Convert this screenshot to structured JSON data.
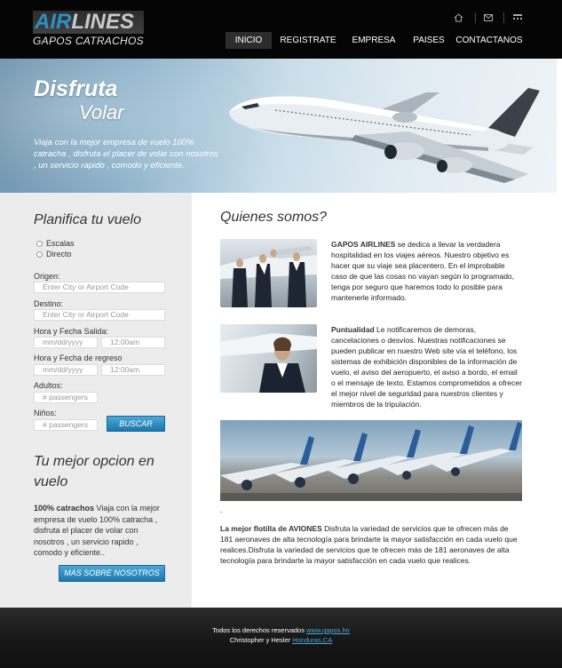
{
  "header": {
    "logo_air": "AIR",
    "logo_lines": "LINES",
    "logo_sub": "GAPOS CATRACHOS",
    "icons": [
      "home-icon",
      "mail-icon",
      "sitemap-icon"
    ],
    "nav": [
      "INICIO",
      "REGISTRATE",
      "EMPRESA",
      "PAISES",
      "CONTACTANOS"
    ]
  },
  "banner": {
    "title": "Disfruta",
    "subtitle": "Volar",
    "text": "Viaja con la mejor empresa de vuelo 100% catracha , disfruta el placer de volar con nosotros , un servicio rapido , comodo y eficiente."
  },
  "sidebar": {
    "title": "Planifica tu vuelo",
    "radio_escalas": "Escalas",
    "radio_directo": "Directo",
    "origen_label": "Origen:",
    "origen_placeholder": "Enter City or Airport Code",
    "destino_label": "Destino:",
    "destino_placeholder": "Enter City or Airport Code",
    "salida_label": "Hora y Fecha Salida:",
    "date_placeholder": "mm/dd/yyyy",
    "time_placeholder": "12:00am",
    "regreso_label": "Hora y Fecha de regreso",
    "adultos_label": "Adultos:",
    "passengers_placeholder": "# passengers",
    "ninos_label": "Niños:",
    "buscar": "BUSCAR",
    "opcion_title_1": "Tu mejor opcion en",
    "opcion_title_2": "vuelo",
    "opcion_bold": "100% catrachos",
    "opcion_text": " Viaja con la mejor empresa de vuelo 100% catracha , disfruta el placer de volar con nosotros , un servicio rapido , comodo y eficiente..",
    "mas_button": "MAS SOBRE NOSOTROS"
  },
  "main": {
    "title": "Quienes somos?",
    "p1_bold": "GAPOS AIRLINES",
    "p1_text": " se dedica a llevar la verdadera hospitalidad en los viajes aéreos. Nuestro objetivo es hacer que su viaje sea placentero. En el improbable caso de que las cosas no vayan según lo programado, tenga por seguro que haremos todo lo posible para mantenerle informado.",
    "p2_bold": "Puntualidad",
    "p2_text": " Le notificaremos de demoras, cancelaciones o desvíos. Nuestras notificaciones se pueden publicar en nuestro Web site vía el teléfono, los sistemas de exhibición disponibles de la información de vuelo, el aviso del aeropuerto, el aviso a bordo, el email o el mensaje de texto. Estamos comprometidos a ofrecer el mejor nivel de seguridad para nuestros clientes y miembros de la tripulación.",
    "dot": ".",
    "p3_bold": "La mejor flotilla de AVIONES",
    "p3_text": " Disfruta la variedad de servicios que te ofrecen más de 181 aeronaves de alta tecnología para brindarte la mayor satisfacción en cada vuelo que realices.Disfruta la variedad de servicios que te ofrecen más de 181 aeronaves de alta tecnología para brindarte la mayor satisfacción en cada vuelo que realices."
  },
  "footer": {
    "rights": "Todos los derechos reservados ",
    "site_link": "www.gapos.hn",
    "authors": "Christopher y Hesler ",
    "place_link": "Honduras,CA"
  }
}
